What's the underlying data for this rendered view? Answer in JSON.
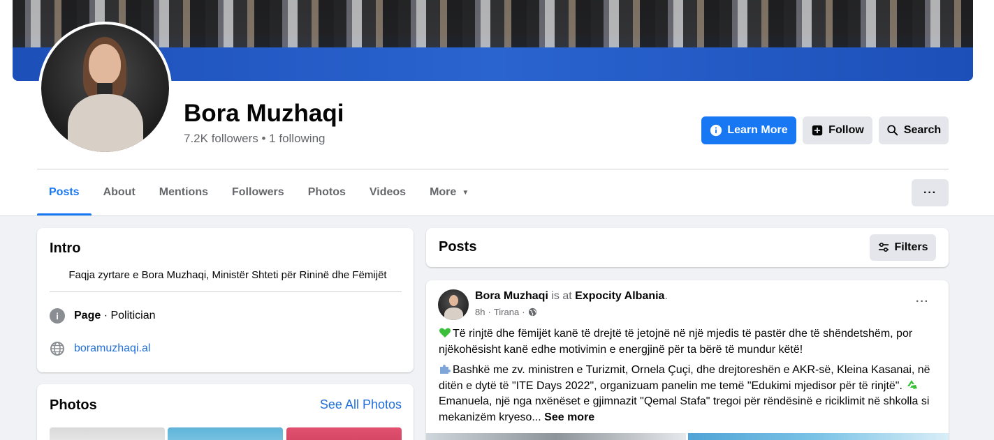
{
  "profile": {
    "name": "Bora Muzhaqi",
    "stats": "7.2K followers • 1 following"
  },
  "actions": {
    "learn_more": "Learn More",
    "follow": "Follow",
    "search": "Search"
  },
  "tabs": [
    {
      "label": "Posts",
      "active": true
    },
    {
      "label": "About"
    },
    {
      "label": "Mentions"
    },
    {
      "label": "Followers"
    },
    {
      "label": "Photos"
    },
    {
      "label": "Videos"
    },
    {
      "label": "More"
    }
  ],
  "more_button": "···",
  "intro": {
    "title": "Intro",
    "bio": "Faqja zyrtare e Bora Muzhaqi, Ministër Shteti për Rininë dhe Fëmijët",
    "category_label": "Page",
    "category_value": " · Politician",
    "website": "boramuzhaqi.al"
  },
  "photos": {
    "title": "Photos",
    "see_all": "See All Photos"
  },
  "posts_section": {
    "title": "Posts",
    "filters": "Filters"
  },
  "post": {
    "author": "Bora Muzhaqi",
    "is_at": " is at ",
    "place": "Expocity Albania",
    "place_suffix": ".",
    "time": "8h",
    "location": "Tirana",
    "menu": "···",
    "paragraph1": "Të rinjtë dhe fëmijët kanë të drejtë të jetojnë në një mjedis të pastër dhe të shëndetshëm, por njëkohësisht kanë edhe motivimin e energjinë për ta bërë të mundur këtë!",
    "paragraph2": "Bashkë me zv. ministren e Turizmit, Ornela Çuçi, dhe drejtoreshën e AKR-së, Kleina Kasanai, në ditën e dytë të \"ITE Days 2022\", organizuam panelin me temë \"Edukimi mjedisor për të rinjtë\". ",
    "paragraph2b": "Emanuela, një nga nxënëset e gjimnazit \"Qemal Stafa\" tregoi për rëndësinë e riciklimit në shkolla si mekanizëm kryeso... ",
    "see_more": "See more"
  },
  "colors": {
    "accent": "#1877f2",
    "link": "#216fdb",
    "secondary_button": "#e4e6eb",
    "background": "#f0f2f5"
  }
}
